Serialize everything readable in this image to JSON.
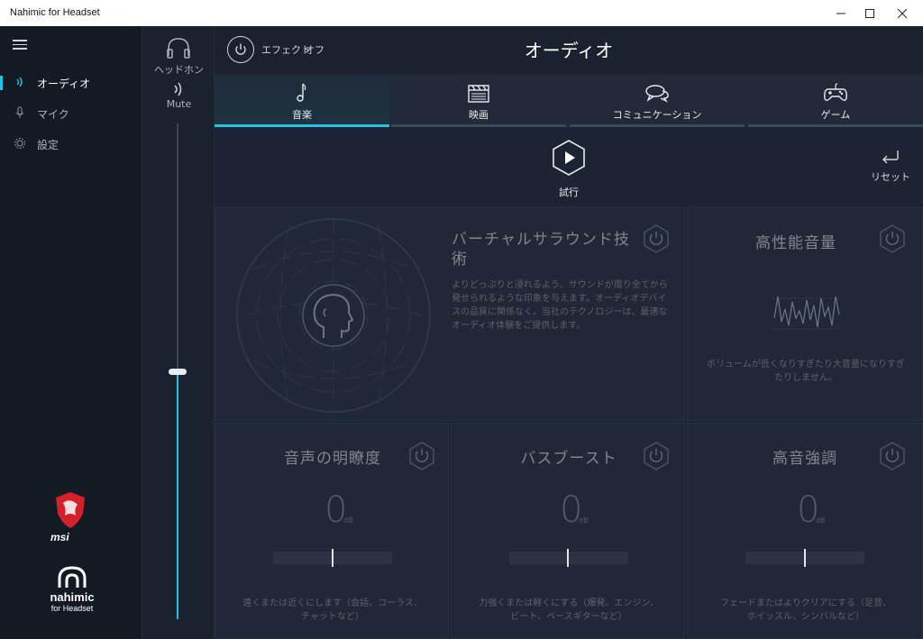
{
  "window": {
    "title": "Nahimic for Headset"
  },
  "sidebar": {
    "items": [
      {
        "label": "オーディオ",
        "icon": "audio-wave-icon",
        "active": true
      },
      {
        "label": "マイク",
        "icon": "microphone-icon",
        "active": false
      },
      {
        "label": "設定",
        "icon": "gear-icon",
        "active": false
      }
    ],
    "brand_msi": "msi",
    "brand_nahimic": "nahimic",
    "brand_nahimic_sub": "for Headset"
  },
  "device": {
    "headphone_label": "ヘッドホン",
    "mute_label": "Mute",
    "volume_level": 0.5
  },
  "header": {
    "effect_label": "エフェクト",
    "effect_state": "オフ",
    "title": "オーディオ"
  },
  "tabs": [
    {
      "label": "音楽",
      "icon": "music-note-icon",
      "active": true
    },
    {
      "label": "映画",
      "icon": "clapperboard-icon",
      "active": false
    },
    {
      "label": "コミュニケーション",
      "icon": "chat-bubbles-icon",
      "active": false
    },
    {
      "label": "ゲーム",
      "icon": "gamepad-icon",
      "active": false
    }
  ],
  "controls": {
    "play_label": "試行",
    "reset_label": "リセット"
  },
  "panels": {
    "surround": {
      "title": "バーチャルサラウンド技術",
      "description": "よりどっぷりと浸れるよう、サウンドが周り全てから発せられるような印象を与えます。オーディオデバイスの品質に関係なく、当社のテクノロジーは、最適なオーディオ体験をご提供します。"
    },
    "volume": {
      "title": "高性能音量",
      "description": "ボリュームが低くなりすぎたり大音量になりすぎたりしません。"
    },
    "voice": {
      "title": "音声の明瞭度",
      "value": "0",
      "unit": "dB",
      "description": "遠くまたは近くにします（会話、コーラス、チャットなど）"
    },
    "bass": {
      "title": "バスブースト",
      "value": "0",
      "unit": "dB",
      "description": "力強くまたは軽くにする（爆発、エンジン、ビート、ベースギターなど）"
    },
    "treble": {
      "title": "高音強調",
      "value": "0",
      "unit": "dB",
      "description": "フェードまたはよりクリアにする（足音、ホイッスル、シンバルなど）"
    }
  },
  "colors": {
    "accent": "#25c0e6",
    "background": "#1b2432",
    "sidebar": "#131a24"
  }
}
